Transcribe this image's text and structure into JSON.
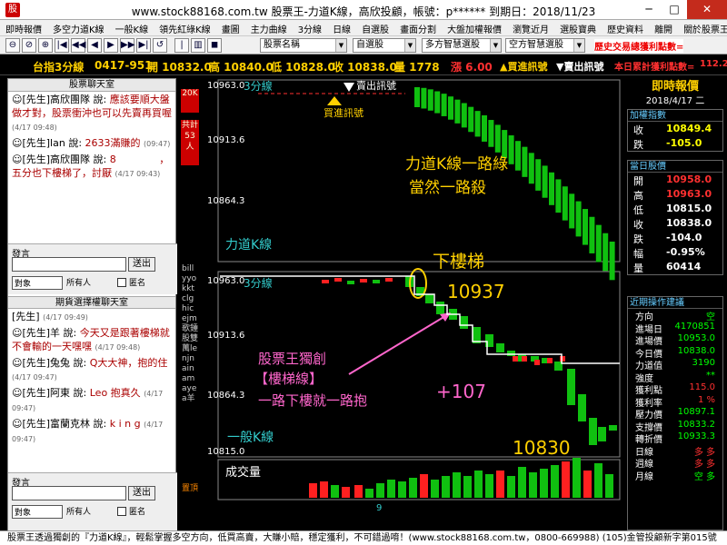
{
  "window": {
    "title": "www.stock88168.com.tw 股票王-力道K線，高欣投顧，帳號：p****** 到期日：2018/11/23",
    "app_icon": "股",
    "minimize": "─",
    "maximize": "□",
    "close": "✕"
  },
  "menu": [
    "即時報價",
    "多空力道K線",
    "一般K線",
    "領先紅綠K線",
    "畫圖",
    "主力曲線",
    "3分線",
    "日線",
    "自選股",
    "畫面分割",
    "大盤加權報價",
    "瀏覽近月",
    "選股寶典",
    "歷史資料",
    "離開",
    "關於股票王"
  ],
  "toolbar": {
    "buttons": [
      {
        "name": "zoom-out-icon",
        "glyph": "⊖"
      },
      {
        "name": "zoom-reset-icon",
        "glyph": "⊘"
      },
      {
        "name": "zoom-in-icon",
        "glyph": "⊕"
      },
      {
        "name": "first-icon",
        "glyph": "|◀"
      },
      {
        "name": "rewind-icon",
        "glyph": "◀◀"
      },
      {
        "name": "prev-icon",
        "glyph": "◀"
      },
      {
        "name": "next-icon",
        "glyph": "▶"
      },
      {
        "name": "forward-icon",
        "glyph": "▶▶"
      },
      {
        "name": "last-icon",
        "glyph": "▶|"
      },
      {
        "name": "refresh-icon",
        "glyph": "↺"
      },
      {
        "name": "ruler-icon",
        "glyph": "|"
      },
      {
        "name": "bar-icon",
        "glyph": "▥"
      },
      {
        "name": "stop-icon",
        "glyph": "◼"
      }
    ],
    "stock_select": "股票名稱",
    "list_select": "自選股",
    "smart_select_1": "多方智慧選股",
    "smart_select_2": "空方智慧選股",
    "alert": "歷史交易總獲利點數="
  },
  "infobar": {
    "name": "台指3分線",
    "time": "0417-951",
    "open": "開 10832.0",
    "high": "高 10840.0",
    "low": "低 10828.0",
    "close": "收 10838.0",
    "volume": "量 1778",
    "change": "漲 6.00",
    "buy_signal": "▲買進訊號",
    "sell_signal": "▼賣出訊號",
    "profit_label": "本日累計獲利點數=",
    "profit_value": "112.2"
  },
  "chat": {
    "header": "股票聊天室",
    "messages": [
      {
        "who": "☺[先生]高欣團隊 說:",
        "text": "應該要順大盤做才對，股票衝沖也可以先賣再買喔",
        "ts": "(4/17 09:48)"
      },
      {
        "who": "☺[先生]lan 說:",
        "text": "2633滿賺的",
        "ts": "(09:47)"
      },
      {
        "who": "☺[先生]高欣團隊 說:",
        "text": "8　　　　 ，五分也下樓梯了，討厭",
        "ts": "(4/17 09:43)"
      }
    ],
    "input_label": "發言",
    "send": "送出",
    "to_combo": "對象",
    "everyone": "所有人",
    "anon": "匿名",
    "header2": "期貨選擇權聊天室",
    "messages2": [
      {
        "who": "[先生]",
        "text": "",
        "ts": "(4/17 09:49)"
      },
      {
        "who": "☺[先生]羊 說:",
        "text": "今天又是跟著樓梯就不會輸的一天嘿嘿",
        "ts": "(4/17 09:48)"
      },
      {
        "who": "☺[先生]兔兔 說:",
        "text": "Q大大神，抱的住",
        "ts": "(4/17 09:47)"
      },
      {
        "who": "☺[先生]阿東 說:",
        "text": "Leo 抱真久",
        "ts": "(4/17 09:47)"
      },
      {
        "who": "☺[先生]富蘭克林 說:",
        "text": "k i n g",
        "ts": "(4/17 09:47)"
      }
    ]
  },
  "strip": {
    "top_tag": "20K",
    "mid_tag": "共計53人",
    "vertical": "billyyokktclghicejm歌鍾股雙萬lenjnainamayea羊",
    "bottom": "置頂"
  },
  "chart": {
    "power_k": {
      "label": "力道K線",
      "ticks": [
        "10963.0",
        "10913.6",
        "10864.3"
      ],
      "annotation_1": "力道K線一路綠",
      "annotation_2": "當然一路殺"
    },
    "three_min": {
      "label": "3分線",
      "ticks": [
        "10963.0",
        "10913.6",
        "10864.3",
        "10815.0"
      ],
      "title": "下樓梯",
      "price_a": "10937",
      "price_b": "+107",
      "price_c": "10830",
      "annot_1": "股票王獨創",
      "annot_2": "【樓梯線】",
      "annot_3": "一路下樓就一路抱"
    },
    "normal_k": {
      "label": "一般K線"
    },
    "volume": {
      "label": "成交量",
      "axis": "9"
    },
    "sell_signal": "賣出訊號",
    "buy_signal": "買進訊號",
    "colors": {
      "up": "#ff2020",
      "down": "#10c010",
      "stair": "#ffffff",
      "text": "#ffd000"
    }
  },
  "right": {
    "title": "即時報價",
    "date": "2018/4/17 二",
    "index_hdr": "加權指數",
    "index": [
      {
        "k": "收",
        "v": "10849.4",
        "c": "#ffff00"
      },
      {
        "k": "跌",
        "v": "-105.0",
        "c": "#ffff00"
      }
    ],
    "today_hdr": "當日股價",
    "today": [
      {
        "k": "開",
        "v": "10958.0",
        "c": "#ff3030"
      },
      {
        "k": "高",
        "v": "10963.0",
        "c": "#ff3030"
      },
      {
        "k": "低",
        "v": "10815.0",
        "c": "#ffffff"
      },
      {
        "k": "收",
        "v": "10838.0",
        "c": "#ffffff"
      },
      {
        "k": "跌",
        "v": "-104.0",
        "c": "#ffffff"
      },
      {
        "k": "幅",
        "v": "-0.95%",
        "c": "#ffffff"
      },
      {
        "k": "量",
        "v": "60414",
        "c": "#ffffff"
      }
    ],
    "advice_hdr": "近期操作建議",
    "advice": [
      {
        "k": "方向",
        "v": "空",
        "c": "#00ff00"
      },
      {
        "k": "進場日",
        "v": "4170851",
        "c": "#00ff00"
      },
      {
        "k": "進場價",
        "v": "10953.0",
        "c": "#00ff00"
      },
      {
        "k": "今日價",
        "v": "10838.0",
        "c": "#00ff00"
      },
      {
        "k": "力道值",
        "v": "3190",
        "c": "#00ff00"
      },
      {
        "k": "強度",
        "v": "**",
        "c": "#00ff00"
      },
      {
        "k": "獲利點",
        "v": "115.0",
        "c": "#ff3030"
      },
      {
        "k": "獲利率",
        "v": "1 %",
        "c": "#ff3030"
      },
      {
        "k": "壓力價",
        "v": "10897.1",
        "c": "#00ff00"
      },
      {
        "k": "支撐價",
        "v": "10833.2",
        "c": "#00ff00"
      },
      {
        "k": "轉折價",
        "v": "10933.3",
        "c": "#00ff00"
      },
      {
        "k": "日線",
        "v": "多 多",
        "c": "#ff3030"
      },
      {
        "k": "週線",
        "v": "多 多",
        "c": "#ff3030"
      },
      {
        "k": "月線",
        "v": "空 多",
        "c": "#00ff00"
      }
    ]
  },
  "footer": "股票王透過獨創的『力道K線』，輕鬆掌握多空方向，低買高賣，大賺小賠，穩定獲利，不可錯過唷！(www.stock88168.com.tw，0800-669988) (105)金管投顧新字第015號"
}
